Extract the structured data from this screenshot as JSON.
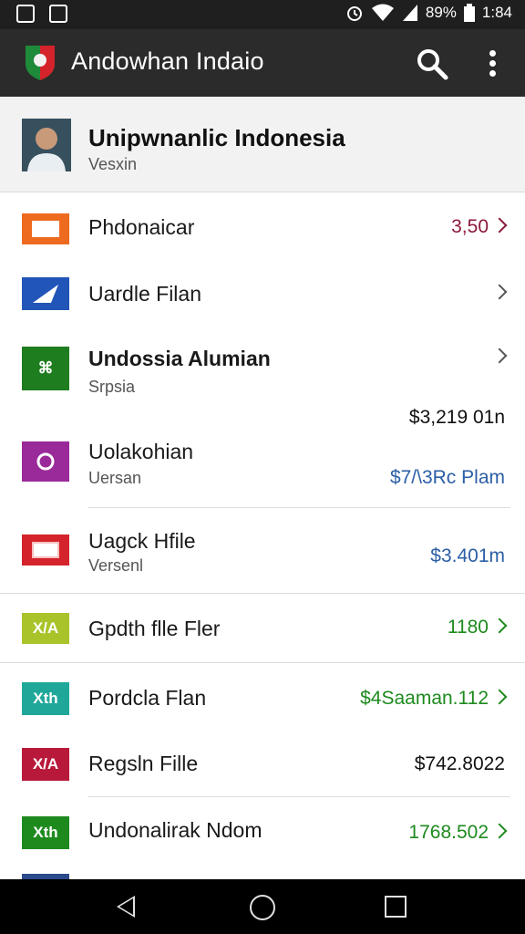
{
  "status_bar": {
    "battery_text": "89%",
    "time": "1:84",
    "icons": [
      "image-icon",
      "gallery-icon",
      "alarm-icon",
      "wifi-icon",
      "signal-icon",
      "battery-icon"
    ]
  },
  "app_bar": {
    "title": "Andowhan Indaio",
    "icons": [
      "app-logo-icon",
      "search-icon",
      "more-vert-icon"
    ]
  },
  "profile": {
    "name": "Unipwnanlic Indonesia",
    "subtitle": "Vesxin"
  },
  "items": [
    {
      "label": "Phdonaicar",
      "sub": "",
      "value": "3,50",
      "chevron": true,
      "value_color": "#8b1a3a",
      "icon_color": "#ee6a1f",
      "icon_text": ""
    },
    {
      "label": "Uardle Filan",
      "sub": "",
      "value": "",
      "chevron": true,
      "value_color": "#555555",
      "icon_color": "#2255b8",
      "icon_text": ""
    },
    {
      "label": "Undossia Alumian",
      "sub": "Srpsia",
      "value": "",
      "chevron": true,
      "value_color": "#555555",
      "icon_color": "#1e7d1e",
      "icon_text": "⌘"
    },
    {
      "label": "Uolakohian",
      "sub": "Uersan",
      "value": "$7/\\3Rc Plam",
      "value_above": "$3,219 01n",
      "chevron": false,
      "value_color": "#2b5fa6",
      "icon_color": "#9a2a9a",
      "icon_text": ""
    },
    {
      "label": "Uagck Hfile",
      "sub": "Versenl",
      "value": "$3.401m",
      "chevron": false,
      "value_color": "#2b5fa6",
      "icon_color": "#d4232a",
      "icon_text": ""
    },
    {
      "label": "Gpdth flle Fler",
      "sub": "",
      "value": "1180",
      "chevron": true,
      "value_color": "#1e8a1e",
      "icon_color": "#a8c42a",
      "icon_text": "X/A"
    },
    {
      "label": "Pordcla Flan",
      "sub": "",
      "value": "$4Saaman.112",
      "chevron": true,
      "value_color": "#1e8a1e",
      "icon_color": "#1fa89a",
      "icon_text": "Xth"
    },
    {
      "label": "Regsln Fille",
      "sub": "",
      "value": "$742.8022",
      "chevron": false,
      "value_color": "#111111",
      "icon_color": "#b8193a",
      "icon_text": "X/A"
    },
    {
      "label": "Undonalirak Ndom",
      "sub": "",
      "value": "1768.502",
      "chevron": true,
      "value_color": "#1e8a1e",
      "icon_color": "#1e8a1e",
      "icon_text": "Xth"
    }
  ],
  "nav_bar": {
    "icons": [
      "back-icon",
      "home-icon",
      "recents-icon"
    ]
  }
}
